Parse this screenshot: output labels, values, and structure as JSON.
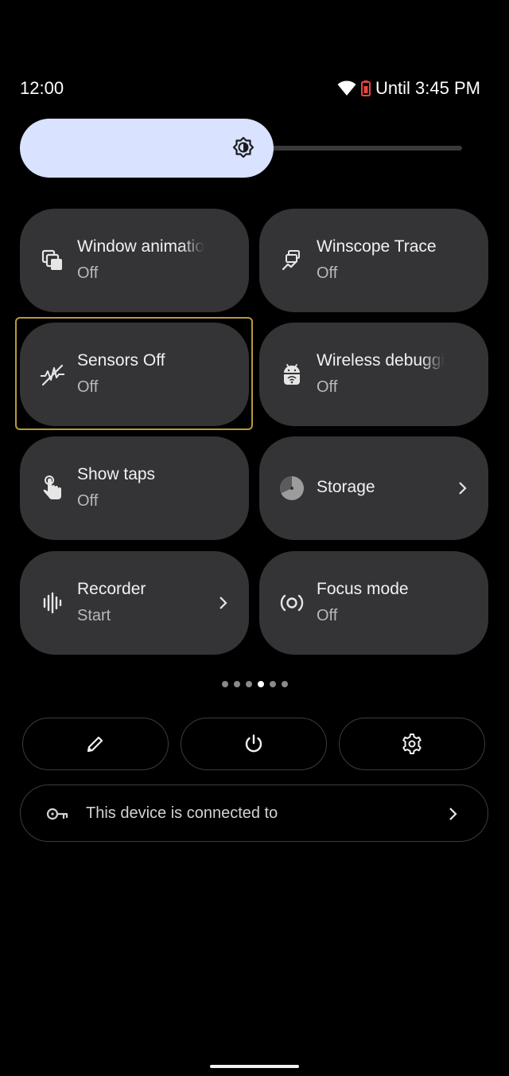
{
  "status": {
    "time": "12:00",
    "battery_text": "Until 3:45 PM"
  },
  "brightness": {
    "level_percent": 55
  },
  "tiles": [
    {
      "title": "Window animatio",
      "subtitle": "Off",
      "icon": "window-animation-icon"
    },
    {
      "title": "Winscope Trace",
      "subtitle": "Off",
      "icon": "winscope-trace-icon"
    },
    {
      "title": "Sensors Off",
      "subtitle": "Off",
      "icon": "sensors-off-icon"
    },
    {
      "title": "Wireless debuggi",
      "subtitle": "Off",
      "icon": "android-wifi-icon"
    },
    {
      "title": "Show taps",
      "subtitle": "Off",
      "icon": "touch-hand-icon"
    },
    {
      "title": "Storage",
      "subtitle": "",
      "icon": "pie-chart-icon"
    },
    {
      "title": "Recorder",
      "subtitle": "Start",
      "icon": "audio-wave-icon"
    },
    {
      "title": "Focus mode",
      "subtitle": "Off",
      "icon": "focus-mode-icon"
    }
  ],
  "pager": {
    "count": 6,
    "active_index": 3
  },
  "footer": {
    "edit_icon": "pencil-icon",
    "power_icon": "power-icon",
    "settings_icon": "gear-icon",
    "security_text": "This device is connected to"
  },
  "colors": {
    "brightness_fill": "#d9e2ff",
    "tile_bg": "#343436",
    "focus_ring": "#b69a3a",
    "battery_saver": "#e8453c"
  }
}
